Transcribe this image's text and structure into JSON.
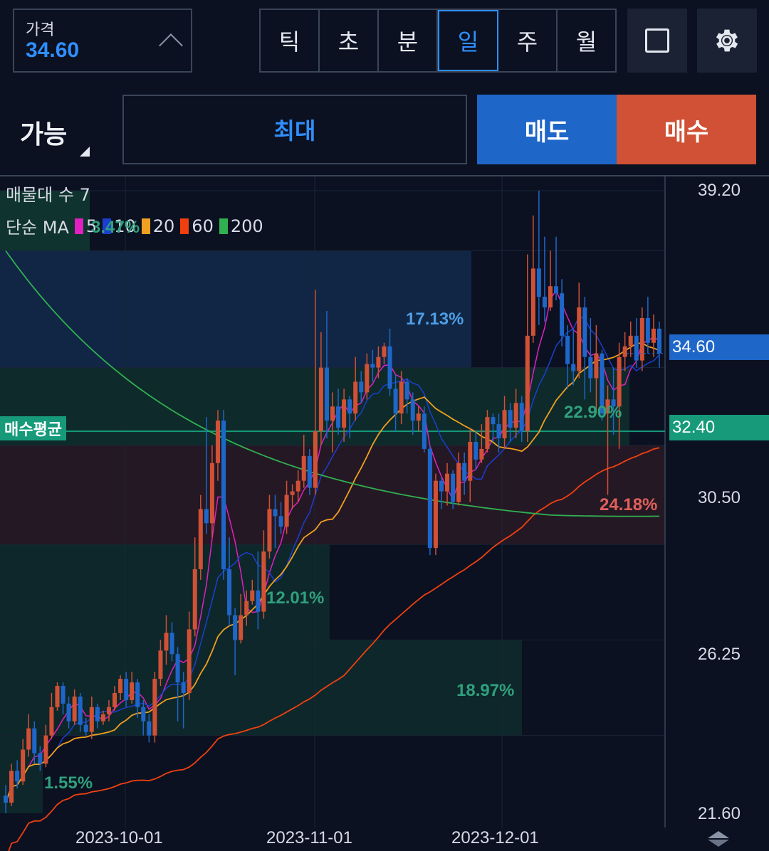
{
  "header": {
    "price_label": "가격",
    "price_value": "34.60",
    "periods": [
      "틱",
      "초",
      "분",
      "일",
      "주",
      "월"
    ],
    "active_period": "일"
  },
  "order": {
    "mode_label": "가능",
    "max_label": "최대",
    "sell_label": "매도",
    "buy_label": "매수"
  },
  "colors": {
    "up": "#d05135",
    "down": "#1f66c9",
    "ma5": "#e020c0",
    "ma10": "#1a3fd0",
    "ma20": "#f0a020",
    "ma60": "#f04010",
    "ma200": "#30b050",
    "avg_line": "#169a7a"
  },
  "legend": {
    "volume_profile": "매물대 수 7",
    "ma_label": "단순 MA",
    "ma_periods": [
      "5",
      "10",
      "20",
      "60",
      "200"
    ]
  },
  "price_tags": {
    "current": "34.60",
    "avg_buy": "32.40",
    "avg_buy_label": "매수평균"
  },
  "chart_data": {
    "type": "candlestick",
    "y_ticks": [
      "39.20",
      "34.60",
      "32.40",
      "30.50",
      "26.25",
      "21.60"
    ],
    "x_ticks": [
      "2023-10-01",
      "2023-11-01",
      "2023-12-01"
    ],
    "ylim": [
      21.6,
      39.2
    ],
    "volume_profile": [
      {
        "low": 37.5,
        "high": 39.2,
        "pct": "3.47%"
      },
      {
        "low": 34.2,
        "high": 37.5,
        "pct": "17.13%"
      },
      {
        "low": 32.0,
        "high": 34.2,
        "pct": "22.90%"
      },
      {
        "low": 29.2,
        "high": 32.0,
        "pct": "24.18%"
      },
      {
        "low": 26.5,
        "high": 29.2,
        "pct": "12.01%"
      },
      {
        "low": 23.8,
        "high": 26.5,
        "pct": "18.97%"
      },
      {
        "low": 21.6,
        "high": 23.8,
        "pct": "1.55%"
      }
    ],
    "candles": [
      [
        22.1,
        21.9,
        22.4,
        21.6
      ],
      [
        21.9,
        22.8,
        23.0,
        21.8
      ],
      [
        22.8,
        22.5,
        23.1,
        22.3
      ],
      [
        22.5,
        23.4,
        23.7,
        22.4
      ],
      [
        23.4,
        24.0,
        24.4,
        23.2
      ],
      [
        24.0,
        23.3,
        24.2,
        23.0
      ],
      [
        23.3,
        23.0,
        23.5,
        22.8
      ],
      [
        23.0,
        23.8,
        24.1,
        22.9
      ],
      [
        23.8,
        24.6,
        25.0,
        23.7
      ],
      [
        24.6,
        25.2,
        25.3,
        24.5
      ],
      [
        25.2,
        24.7,
        25.3,
        24.4
      ],
      [
        24.7,
        24.2,
        24.9,
        24.0
      ],
      [
        24.2,
        24.9,
        25.1,
        24.1
      ],
      [
        24.9,
        24.1,
        25.0,
        23.9
      ],
      [
        24.1,
        23.9,
        24.3,
        23.8
      ],
      [
        23.9,
        24.6,
        24.9,
        23.7
      ],
      [
        24.6,
        24.2,
        24.7,
        24.0
      ],
      [
        24.2,
        24.4,
        24.5,
        24.1
      ],
      [
        24.4,
        24.6,
        24.8,
        24.2
      ],
      [
        24.6,
        25.0,
        25.2,
        24.5
      ],
      [
        25.0,
        25.4,
        25.5,
        24.8
      ],
      [
        25.4,
        24.8,
        25.6,
        24.6
      ],
      [
        24.8,
        25.3,
        25.6,
        24.7
      ],
      [
        25.3,
        24.6,
        25.4,
        24.3
      ],
      [
        24.6,
        24.2,
        24.8,
        23.8
      ],
      [
        24.2,
        23.8,
        24.4,
        23.6
      ],
      [
        23.8,
        25.4,
        25.6,
        23.6
      ],
      [
        25.4,
        26.2,
        26.5,
        25.2
      ],
      [
        26.2,
        26.7,
        27.2,
        25.8
      ],
      [
        26.7,
        26.1,
        27.0,
        25.9
      ],
      [
        26.1,
        25.3,
        26.3,
        24.2
      ],
      [
        25.3,
        25.0,
        25.6,
        24.0
      ],
      [
        25.0,
        26.8,
        27.3,
        24.8
      ],
      [
        26.8,
        28.5,
        29.4,
        26.6
      ],
      [
        28.5,
        30.2,
        30.6,
        28.2
      ],
      [
        30.2,
        29.8,
        32.8,
        29.5
      ],
      [
        29.8,
        31.5,
        32.0,
        29.4
      ],
      [
        31.5,
        32.7,
        33.0,
        31.0
      ],
      [
        32.7,
        28.5,
        33.0,
        28.2
      ],
      [
        28.5,
        27.2,
        29.4,
        26.9
      ],
      [
        27.2,
        26.5,
        27.4,
        25.5
      ],
      [
        26.5,
        27.2,
        27.8,
        26.4
      ],
      [
        27.2,
        27.6,
        27.9,
        26.9
      ],
      [
        27.6,
        27.9,
        28.2,
        27.5
      ],
      [
        27.9,
        27.3,
        29.0,
        26.8
      ],
      [
        27.3,
        29.0,
        29.6,
        27.1
      ],
      [
        29.0,
        30.2,
        30.6,
        28.8
      ],
      [
        30.2,
        30.0,
        30.6,
        29.1
      ],
      [
        30.0,
        29.7,
        30.4,
        29.5
      ],
      [
        29.7,
        30.6,
        31.0,
        29.5
      ],
      [
        30.6,
        30.7,
        30.9,
        30.2
      ],
      [
        30.7,
        31.0,
        31.3,
        30.4
      ],
      [
        31.0,
        31.7,
        32.3,
        30.8
      ],
      [
        31.7,
        30.8,
        31.9,
        30.6
      ],
      [
        30.8,
        32.4,
        36.4,
        30.6
      ],
      [
        32.4,
        34.2,
        35.2,
        32.0
      ],
      [
        34.2,
        32.7,
        35.8,
        32.2
      ],
      [
        32.7,
        33.1,
        33.5,
        31.8
      ],
      [
        33.1,
        32.5,
        33.6,
        32.3
      ],
      [
        32.5,
        33.3,
        33.6,
        32.1
      ],
      [
        33.3,
        32.9,
        33.4,
        32.2
      ],
      [
        32.9,
        33.8,
        34.5,
        32.7
      ],
      [
        33.8,
        33.5,
        34.1,
        33.2
      ],
      [
        33.5,
        34.3,
        34.6,
        33.3
      ],
      [
        34.3,
        34.2,
        34.7,
        33.8
      ],
      [
        34.2,
        34.5,
        34.8,
        33.9
      ],
      [
        34.5,
        34.8,
        34.9,
        34.3
      ],
      [
        34.8,
        33.6,
        35.3,
        33.4
      ],
      [
        33.6,
        32.9,
        34.0,
        32.4
      ],
      [
        32.9,
        33.8,
        34.1,
        32.6
      ],
      [
        33.8,
        33.3,
        33.9,
        32.9
      ],
      [
        33.3,
        32.7,
        33.5,
        32.3
      ],
      [
        32.7,
        32.9,
        33.1,
        32.4
      ],
      [
        32.9,
        31.9,
        33.1,
        31.8
      ],
      [
        31.9,
        29.1,
        32.0,
        28.9
      ],
      [
        29.1,
        31.0,
        31.2,
        28.9
      ],
      [
        31.0,
        30.7,
        31.1,
        30.2
      ],
      [
        30.7,
        31.2,
        31.5,
        30.3
      ],
      [
        31.2,
        30.4,
        31.3,
        30.2
      ],
      [
        30.4,
        31.5,
        31.8,
        30.3
      ],
      [
        31.5,
        31.0,
        31.8,
        30.6
      ],
      [
        31.0,
        32.1,
        32.5,
        30.4
      ],
      [
        32.1,
        31.6,
        32.4,
        31.3
      ],
      [
        31.6,
        31.9,
        32.6,
        31.5
      ],
      [
        31.9,
        32.8,
        33.0,
        31.8
      ],
      [
        32.8,
        32.6,
        32.9,
        32.1
      ],
      [
        32.6,
        32.2,
        32.9,
        31.8
      ],
      [
        32.2,
        33.0,
        33.4,
        31.9
      ],
      [
        33.0,
        32.5,
        33.2,
        32.1
      ],
      [
        32.5,
        33.2,
        33.6,
        32.2
      ],
      [
        33.2,
        32.4,
        33.4,
        32.1
      ],
      [
        32.4,
        35.1,
        37.4,
        32.1
      ],
      [
        35.1,
        37.0,
        38.5,
        34.9
      ],
      [
        37.0,
        36.2,
        39.2,
        35.4
      ],
      [
        36.2,
        35.9,
        37.9,
        35.5
      ],
      [
        35.9,
        36.5,
        37.5,
        35.8
      ],
      [
        36.5,
        36.3,
        37.9,
        36.1
      ],
      [
        36.3,
        35.1,
        36.7,
        34.8
      ],
      [
        35.1,
        34.3,
        35.4,
        33.6
      ],
      [
        34.3,
        34.1,
        35.3,
        33.7
      ],
      [
        34.1,
        35.9,
        36.6,
        33.9
      ],
      [
        35.9,
        34.5,
        36.2,
        33.3
      ],
      [
        34.5,
        33.9,
        35.6,
        33.5
      ],
      [
        33.9,
        34.6,
        35.4,
        32.9
      ],
      [
        34.6,
        32.9,
        34.7,
        32.7
      ],
      [
        32.9,
        33.3,
        33.7,
        30.6
      ],
      [
        33.3,
        33.1,
        34.2,
        32.3
      ],
      [
        33.1,
        34.5,
        34.9,
        31.9
      ],
      [
        34.5,
        34.8,
        35.2,
        34.1
      ],
      [
        34.8,
        35.1,
        35.5,
        34.5
      ],
      [
        35.1,
        34.4,
        35.6,
        34.2
      ],
      [
        34.4,
        35.6,
        35.9,
        34.1
      ],
      [
        35.6,
        34.9,
        36.2,
        34.6
      ],
      [
        34.9,
        35.3,
        35.7,
        34.5
      ],
      [
        35.3,
        34.6,
        35.5,
        34.2
      ]
    ]
  }
}
